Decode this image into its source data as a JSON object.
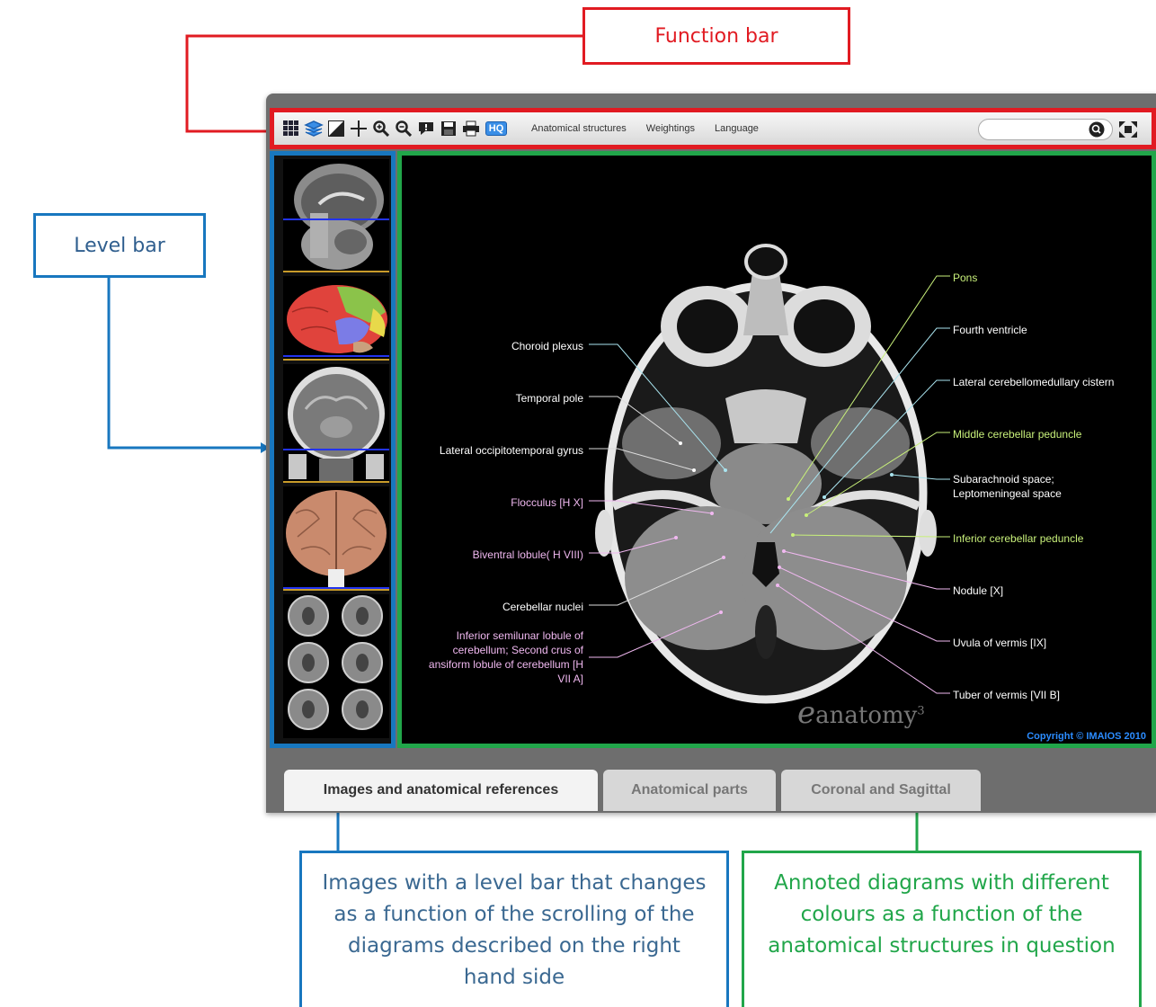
{
  "callouts": {
    "function_bar": "Function bar",
    "level_bar": "Level bar",
    "images_desc": "Images with a level bar that changes as a function of the scrolling of the diagrams described on the right hand side",
    "diagrams_desc": "Annoted diagrams with different colours as a function of the anatomical structures in question"
  },
  "colors": {
    "function_bar": "#e11b22",
    "level_bar": "#1877bf",
    "diagram_area": "#21a64a",
    "label_white": "#ffffff",
    "label_pink": "#f0b8f0",
    "label_green": "#c8f07a",
    "label_cyan": "#a9e4ef"
  },
  "toolbar": {
    "icons": [
      "grid-icon",
      "layers-icon",
      "contrast-icon",
      "crosshair-icon",
      "zoom-in-icon",
      "zoom-out-icon",
      "comment-icon",
      "save-icon",
      "print-icon",
      "hq-icon"
    ],
    "hq_label": "HQ",
    "menus": [
      "Anatomical structures",
      "Weightings",
      "Language"
    ],
    "search_value": ""
  },
  "level_thumbs": [
    "sagittal-mri",
    "lateral-brain-3d",
    "coronal-mri",
    "posterior-brain-3d",
    "axial-series"
  ],
  "labels_left": [
    {
      "text": "Choroid plexus",
      "color": "label_white"
    },
    {
      "text": "Temporal pole",
      "color": "label_white"
    },
    {
      "text": "Lateral occipitotemporal gyrus",
      "color": "label_white"
    },
    {
      "text": "Flocculus [H X]",
      "color": "label_pink"
    },
    {
      "text": "Biventral lobule( H VIII)",
      "color": "label_pink"
    },
    {
      "text": "Cerebellar nuclei",
      "color": "label_white"
    },
    {
      "text": "Inferior semilunar lobule of\ncerebellum; Second crus of\nansiform lobule of cerebellum [H\nVII A]",
      "color": "label_pink"
    }
  ],
  "labels_right": [
    {
      "text": "Pons",
      "color": "label_green"
    },
    {
      "text": "Fourth ventricle",
      "color": "label_white"
    },
    {
      "text": "Lateral cerebellomedullary cistern",
      "color": "label_white"
    },
    {
      "text": "Middle cerebellar peduncle",
      "color": "label_green"
    },
    {
      "text": "Subarachnoid space;\nLeptomeningeal space",
      "color": "label_white"
    },
    {
      "text": "Inferior cerebellar peduncle",
      "color": "label_green"
    },
    {
      "text": "Nodule [X]",
      "color": "label_white"
    },
    {
      "text": "Uvula of vermis [IX]",
      "color": "label_white"
    },
    {
      "text": "Tuber of vermis [VII B]",
      "color": "label_white"
    }
  ],
  "logo": {
    "text": "anatomy",
    "sup": "3"
  },
  "copyright": "Copyright © IMAIOS 2010",
  "tabs": [
    "Images and anatomical references",
    "Anatomical parts",
    "Coronal and Sagittal"
  ]
}
